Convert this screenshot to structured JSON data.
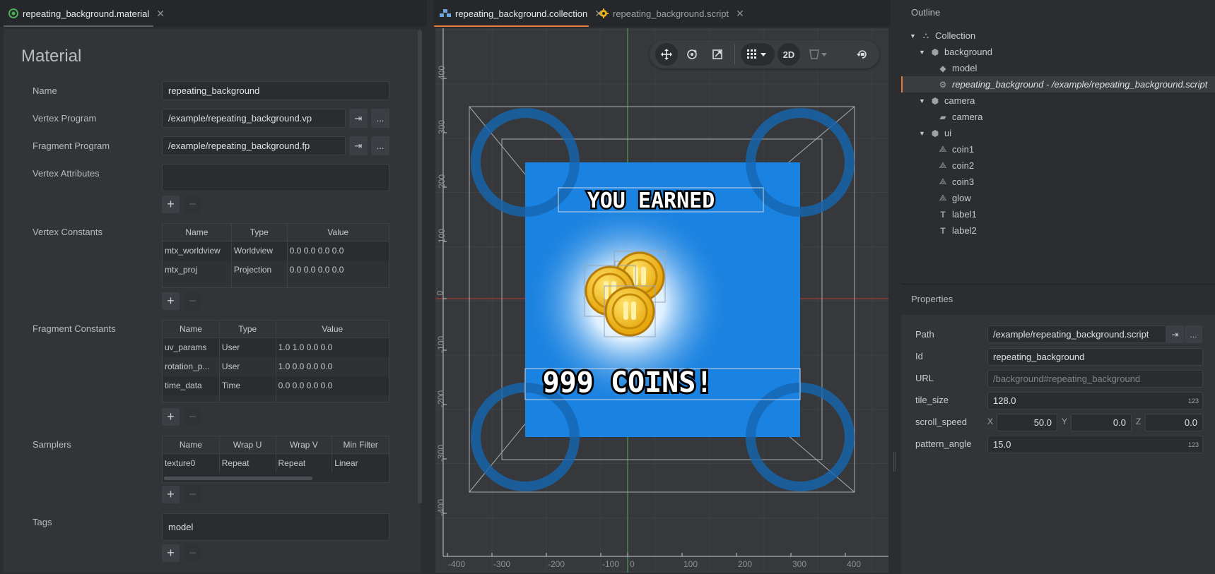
{
  "left_panel": {
    "tab_label": "repeating_background.material",
    "title": "Material",
    "fields": {
      "name_label": "Name",
      "name_value": "repeating_background",
      "vertex_program_label": "Vertex Program",
      "vertex_program_value": "/example/repeating_background.vp",
      "fragment_program_label": "Fragment Program",
      "fragment_program_value": "/example/repeating_background.fp",
      "vertex_attributes_label": "Vertex Attributes",
      "vertex_constants_label": "Vertex Constants",
      "fragment_constants_label": "Fragment Constants",
      "samplers_label": "Samplers",
      "tags_label": "Tags",
      "tags_value": "model"
    },
    "goto_glyph": "⇥",
    "browse_glyph": "...",
    "plus_glyph": "+",
    "minus_glyph": "−",
    "vertex_constants": {
      "headers": [
        "Name",
        "Type",
        "Value"
      ],
      "rows": [
        [
          "mtx_worldview",
          "Worldview",
          "0.0  0.0  0.0  0.0"
        ],
        [
          "mtx_proj",
          "Projection",
          "0.0  0.0  0.0  0.0"
        ]
      ]
    },
    "fragment_constants": {
      "headers": [
        "Name",
        "Type",
        "Value"
      ],
      "rows": [
        [
          "uv_params",
          "User",
          "1.0  1.0  0.0  0.0"
        ],
        [
          "rotation_p...",
          "User",
          "1.0  0.0  0.0  0.0"
        ],
        [
          "time_data",
          "Time",
          "0.0  0.0  0.0  0.0"
        ]
      ]
    },
    "samplers": {
      "headers": [
        "Name",
        "Wrap U",
        "Wrap V",
        "Min Filter"
      ],
      "rows": [
        [
          "texture0",
          "Repeat",
          "Repeat",
          "Linear"
        ]
      ]
    }
  },
  "center_panel": {
    "tabs": [
      {
        "label": "repeating_background.collection",
        "icon": "collection-icon",
        "active": true
      },
      {
        "label": "repeating_background.script",
        "icon": "script-gear-icon",
        "active": false
      }
    ],
    "toolbar": {
      "move": "move-tool-icon",
      "rotate": "rotate-tool-icon",
      "scale": "scale-tool-icon",
      "grid": "grid-icon",
      "mode_2d": "2D",
      "visibility": "visibility-filter-icon",
      "camera": "reset-camera-icon"
    },
    "scene": {
      "title_text": "YOU EARNED",
      "coins_text": "999 COINS!"
    },
    "axis_x_labels": [
      "-400",
      "-300",
      "-200",
      "-100",
      "0",
      "100",
      "200",
      "300",
      "400"
    ],
    "axis_y_labels": [
      "400",
      "300",
      "200",
      "100",
      "0",
      "-100",
      "-200",
      "-300",
      "-400"
    ],
    "accent_color": "#e07b3a"
  },
  "outline": {
    "header": "Outline",
    "tree": [
      {
        "label": "Collection",
        "icon": "collection-icon",
        "level": 0,
        "expanded": true
      },
      {
        "label": "background",
        "icon": "game-object-icon",
        "level": 1,
        "expanded": true
      },
      {
        "label": "model",
        "icon": "model-icon",
        "level": 2
      },
      {
        "label": "repeating_background - /example/repeating_background.script",
        "icon": "script-gear-icon",
        "level": 2,
        "selected": true
      },
      {
        "label": "camera",
        "icon": "game-object-icon",
        "level": 1,
        "expanded": true
      },
      {
        "label": "camera",
        "icon": "camera-icon",
        "level": 2
      },
      {
        "label": "ui",
        "icon": "game-object-icon",
        "level": 1,
        "expanded": true
      },
      {
        "label": "coin1",
        "icon": "sprite-icon",
        "level": 2
      },
      {
        "label": "coin2",
        "icon": "sprite-icon",
        "level": 2
      },
      {
        "label": "coin3",
        "icon": "sprite-icon",
        "level": 2
      },
      {
        "label": "glow",
        "icon": "sprite-icon",
        "level": 2
      },
      {
        "label": "label1",
        "icon": "label-icon",
        "level": 2
      },
      {
        "label": "label2",
        "icon": "label-icon",
        "level": 2
      }
    ]
  },
  "properties": {
    "header": "Properties",
    "path_label": "Path",
    "path_value": "/example/repeating_background.script",
    "id_label": "Id",
    "id_value": "repeating_background",
    "url_label": "URL",
    "url_value": "/background#repeating_background",
    "tile_size_label": "tile_size",
    "tile_size_value": "128.0",
    "scroll_speed_label": "scroll_speed",
    "scroll_x_label": "X",
    "scroll_x": "50.0",
    "scroll_y_label": "Y",
    "scroll_y": "0.0",
    "scroll_z_label": "Z",
    "scroll_z": "0.0",
    "pattern_angle_label": "pattern_angle",
    "pattern_angle_value": "15.0",
    "numeric_badge": "123"
  }
}
